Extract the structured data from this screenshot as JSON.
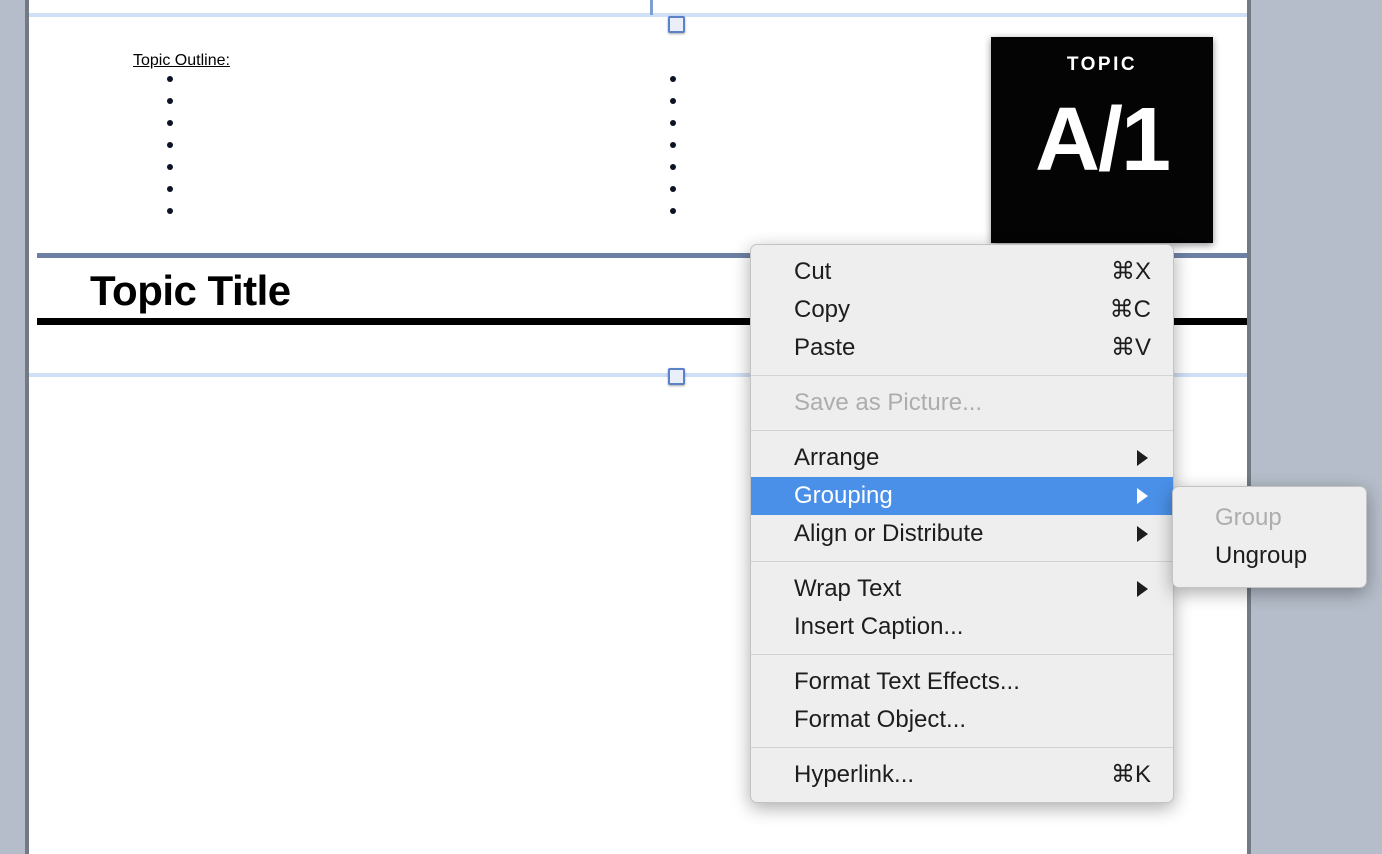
{
  "colors": {
    "app_background": "#b5bdca",
    "page_background": "#ffffff",
    "page_border": "#747a84",
    "menu_background": "#eeeeee",
    "menu_text": "#1d1d1d",
    "menu_disabled_text": "#adadad",
    "menu_highlight": "#4a90e8",
    "menu_highlight_text": "#ffffff",
    "selection_line": "#cfdff5",
    "selection_handle_border": "#5b81c8",
    "title_rule_top": "#6d80a3",
    "title_rule_bottom": "#000000",
    "badge_background": "#040404",
    "badge_text": "#ffffff"
  },
  "document": {
    "outline_heading": "Topic Outline:",
    "bullet_columns": [
      {
        "name": "left-column",
        "bullets": [
          "",
          "",
          "",
          "",
          "",
          "",
          ""
        ]
      },
      {
        "name": "right-column",
        "bullets": [
          "",
          "",
          "",
          "",
          "",
          "",
          ""
        ]
      }
    ],
    "badge": {
      "kicker": "TOPIC",
      "code": "A/1"
    },
    "title": "Topic Title",
    "selection": {
      "handle_top": "top-center-resize-handle",
      "handle_bottom": "bottom-center-resize-handle"
    }
  },
  "context_menu": {
    "groups": [
      {
        "items": [
          {
            "label": "Cut",
            "shortcut": "⌘X",
            "disabled": false,
            "submenu": false,
            "selected": false
          },
          {
            "label": "Copy",
            "shortcut": "⌘C",
            "disabled": false,
            "submenu": false,
            "selected": false
          },
          {
            "label": "Paste",
            "shortcut": "⌘V",
            "disabled": false,
            "submenu": false,
            "selected": false
          }
        ]
      },
      {
        "items": [
          {
            "label": "Save as Picture...",
            "shortcut": "",
            "disabled": true,
            "submenu": false,
            "selected": false
          }
        ]
      },
      {
        "items": [
          {
            "label": "Arrange",
            "shortcut": "",
            "disabled": false,
            "submenu": true,
            "selected": false
          },
          {
            "label": "Grouping",
            "shortcut": "",
            "disabled": false,
            "submenu": true,
            "selected": true
          },
          {
            "label": "Align or Distribute",
            "shortcut": "",
            "disabled": false,
            "submenu": true,
            "selected": false
          }
        ]
      },
      {
        "items": [
          {
            "label": "Wrap Text",
            "shortcut": "",
            "disabled": false,
            "submenu": true,
            "selected": false
          },
          {
            "label": "Insert Caption...",
            "shortcut": "",
            "disabled": false,
            "submenu": false,
            "selected": false
          }
        ]
      },
      {
        "items": [
          {
            "label": "Format Text Effects...",
            "shortcut": "",
            "disabled": false,
            "submenu": false,
            "selected": false
          },
          {
            "label": "Format Object...",
            "shortcut": "",
            "disabled": false,
            "submenu": false,
            "selected": false
          }
        ]
      },
      {
        "items": [
          {
            "label": "Hyperlink...",
            "shortcut": "⌘K",
            "disabled": false,
            "submenu": false,
            "selected": false
          }
        ]
      }
    ]
  },
  "submenu": {
    "parent": "Grouping",
    "items": [
      {
        "label": "Group",
        "disabled": true
      },
      {
        "label": "Ungroup",
        "disabled": false
      }
    ]
  }
}
